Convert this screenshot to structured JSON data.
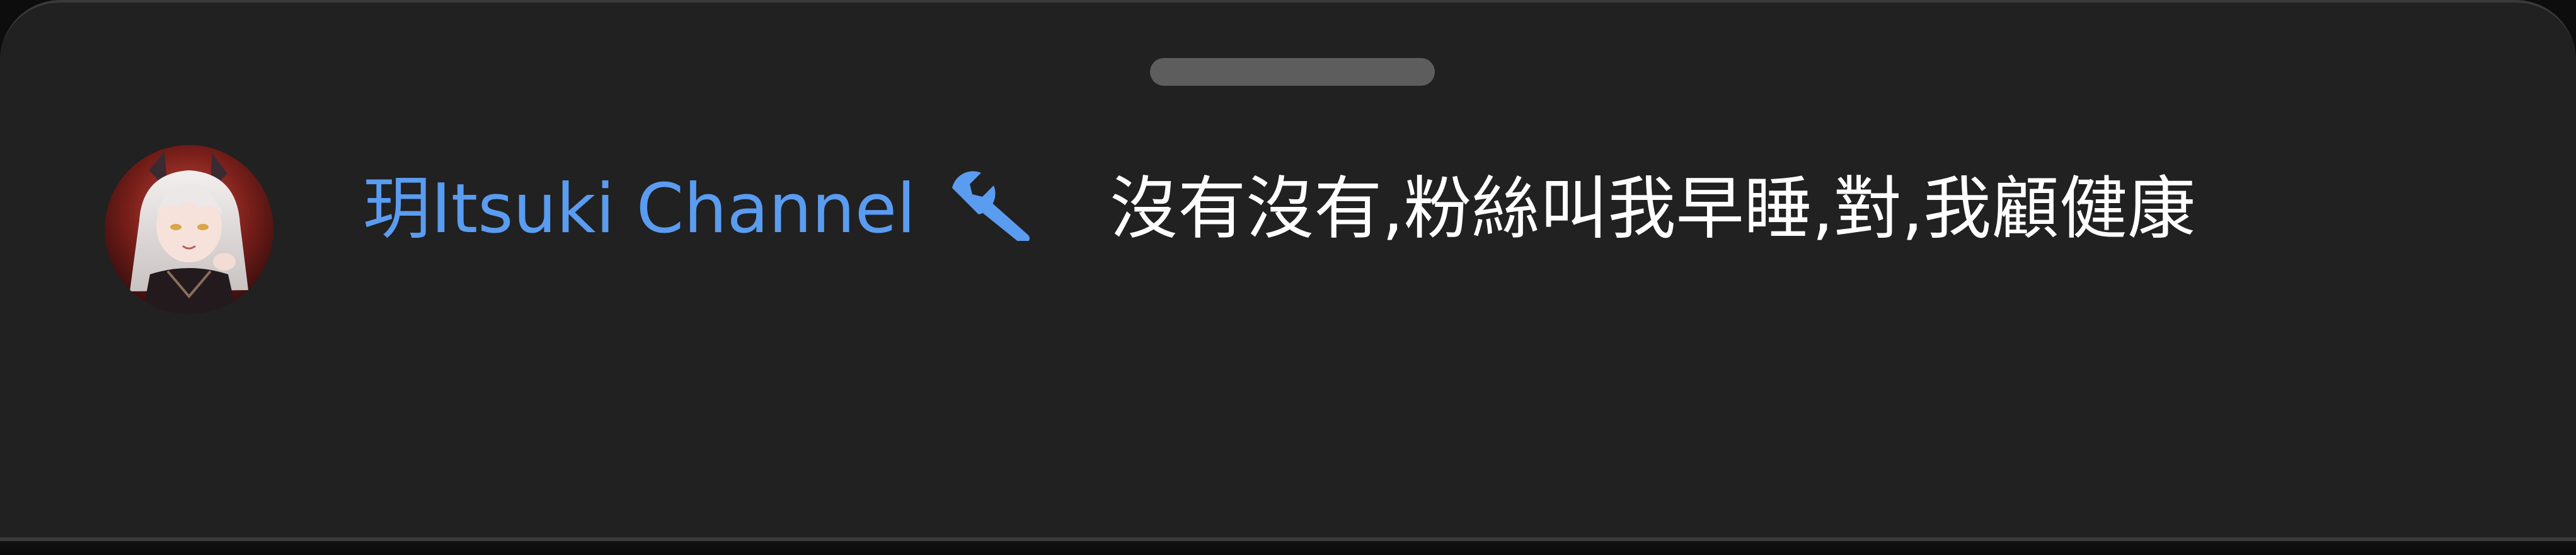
{
  "comment": {
    "author": "玥Itsuki Channel",
    "author_badge_icon": "wrench-icon",
    "text": "沒有沒有,粉絲叫我早睡,對,我顧健康",
    "author_color": "#5a9cf0",
    "text_color": "#ffffff"
  },
  "sheet": {
    "background_color": "#212121"
  }
}
